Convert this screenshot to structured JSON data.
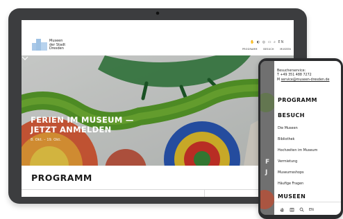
{
  "logo": {
    "line1": "Museen",
    "line2": "der Stadt",
    "line3": "Dresden"
  },
  "header": {
    "icons": [
      "sign-language-icon",
      "easy-language-icon",
      "accessibility-icon",
      "ticket-icon",
      "search-icon"
    ],
    "lang": "EN",
    "nav": [
      "PROGRAMM",
      "BESUCH",
      "MUSEEN"
    ]
  },
  "hero": {
    "title_line1": "FERIEN IM MUSEUM —",
    "title_line2": "JETZT ANMELDEN",
    "date": "8. Okt. – 19. Okt."
  },
  "section": {
    "title": "PROGRAMM"
  },
  "phone": {
    "contact_heading": "Besucherservice:",
    "phone": "T +49 351 488 7272",
    "mail_prefix": "M",
    "mail": "service@museen-dresden.de",
    "menu_program": "PROGRAMM",
    "menu_besuch": "BESUCH",
    "items": [
      "Die Museen",
      "Bibliothek",
      "Hochzeiten im Museum",
      "Vermietung",
      "Museumsshops",
      "Häufige Fragen"
    ],
    "menu_museen": "MUSEEN",
    "footer_lang": "EN"
  },
  "colors": {
    "device": "#3c3d3f",
    "phone": "#2b2c2e",
    "accent_blue": "#9fc2e4"
  }
}
